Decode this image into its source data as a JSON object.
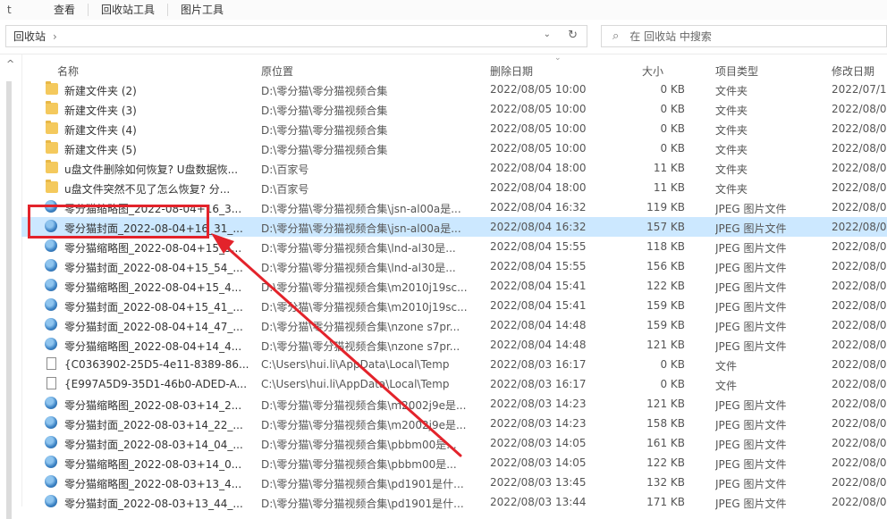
{
  "ribbon": {
    "lead": "t",
    "tabs": [
      "查看",
      "回收站工具",
      "图片工具"
    ]
  },
  "address": {
    "path": "回收站",
    "chevron": "›",
    "dropdown": "⌄",
    "refresh": "↻"
  },
  "search": {
    "placeholder": "在 回收站 中搜索"
  },
  "columns": {
    "name": "名称",
    "location": "原位置",
    "deleted": "删除日期",
    "size": "大小",
    "type": "项目类型",
    "modified": "修改日期"
  },
  "rows": [
    {
      "icon": "folder",
      "name": "新建文件夹 (2)",
      "location": "D:\\零分猫\\零分猫视频合集",
      "deleted": "2022/08/05 10:00",
      "size": "0 KB",
      "type": "文件夹",
      "modified": "2022/07/1"
    },
    {
      "icon": "folder",
      "name": "新建文件夹 (3)",
      "location": "D:\\零分猫\\零分猫视频合集",
      "deleted": "2022/08/05 10:00",
      "size": "0 KB",
      "type": "文件夹",
      "modified": "2022/08/0"
    },
    {
      "icon": "folder",
      "name": "新建文件夹 (4)",
      "location": "D:\\零分猫\\零分猫视频合集",
      "deleted": "2022/08/05 10:00",
      "size": "0 KB",
      "type": "文件夹",
      "modified": "2022/08/0"
    },
    {
      "icon": "folder",
      "name": "新建文件夹 (5)",
      "location": "D:\\零分猫\\零分猫视频合集",
      "deleted": "2022/08/05 10:00",
      "size": "0 KB",
      "type": "文件夹",
      "modified": "2022/08/0"
    },
    {
      "icon": "folder",
      "name": "u盘文件删除如何恢复? U盘数据恢...",
      "location": "D:\\百家号",
      "deleted": "2022/08/04 18:00",
      "size": "11 KB",
      "type": "文件夹",
      "modified": "2022/08/0"
    },
    {
      "icon": "folder",
      "name": "u盘文件突然不见了怎么恢复? 分...",
      "location": "D:\\百家号",
      "deleted": "2022/08/04 18:00",
      "size": "11 KB",
      "type": "文件夹",
      "modified": "2022/08/0"
    },
    {
      "icon": "jpeg",
      "name": "零分猫缩略图_2022-08-04+16_3...",
      "location": "D:\\零分猫\\零分猫视频合集\\jsn-al00a是...",
      "deleted": "2022/08/04 16:32",
      "size": "119 KB",
      "type": "JPEG 图片文件",
      "modified": "2022/08/0"
    },
    {
      "icon": "jpeg",
      "name": "零分猫封面_2022-08-04+16_31_...",
      "location": "D:\\零分猫\\零分猫视频合集\\jsn-al00a是...",
      "deleted": "2022/08/04 16:32",
      "size": "157 KB",
      "type": "JPEG 图片文件",
      "modified": "2022/08/0",
      "selected": true
    },
    {
      "icon": "jpeg",
      "name": "零分猫缩略图_2022-08-04+15_5...",
      "location": "D:\\零分猫\\零分猫视频合集\\lnd-al30是...",
      "deleted": "2022/08/04 15:55",
      "size": "118 KB",
      "type": "JPEG 图片文件",
      "modified": "2022/08/0"
    },
    {
      "icon": "jpeg",
      "name": "零分猫封面_2022-08-04+15_54_...",
      "location": "D:\\零分猫\\零分猫视频合集\\lnd-al30是...",
      "deleted": "2022/08/04 15:55",
      "size": "156 KB",
      "type": "JPEG 图片文件",
      "modified": "2022/08/0"
    },
    {
      "icon": "jpeg",
      "name": "零分猫缩略图_2022-08-04+15_4...",
      "location": "D:\\零分猫\\零分猫视频合集\\m2010j19sc...",
      "deleted": "2022/08/04 15:41",
      "size": "122 KB",
      "type": "JPEG 图片文件",
      "modified": "2022/08/0"
    },
    {
      "icon": "jpeg",
      "name": "零分猫封面_2022-08-04+15_41_...",
      "location": "D:\\零分猫\\零分猫视频合集\\m2010j19sc...",
      "deleted": "2022/08/04 15:41",
      "size": "159 KB",
      "type": "JPEG 图片文件",
      "modified": "2022/08/0"
    },
    {
      "icon": "jpeg",
      "name": "零分猫封面_2022-08-04+14_47_...",
      "location": "D:\\零分猫\\零分猫视频合集\\nzone s7pr...",
      "deleted": "2022/08/04 14:48",
      "size": "159 KB",
      "type": "JPEG 图片文件",
      "modified": "2022/08/0"
    },
    {
      "icon": "jpeg",
      "name": "零分猫缩略图_2022-08-04+14_4...",
      "location": "D:\\零分猫\\零分猫视频合集\\nzone s7pr...",
      "deleted": "2022/08/04 14:48",
      "size": "121 KB",
      "type": "JPEG 图片文件",
      "modified": "2022/08/0"
    },
    {
      "icon": "file",
      "name": "{C0363902-25D5-4e11-8389-86...",
      "location": "C:\\Users\\hui.li\\AppData\\Local\\Temp",
      "deleted": "2022/08/03 16:17",
      "size": "0 KB",
      "type": "文件",
      "modified": "2022/08/0"
    },
    {
      "icon": "file",
      "name": "{E997A5D9-35D1-46b0-ADED-A...",
      "location": "C:\\Users\\hui.li\\AppData\\Local\\Temp",
      "deleted": "2022/08/03 16:17",
      "size": "0 KB",
      "type": "文件",
      "modified": "2022/08/0"
    },
    {
      "icon": "jpeg",
      "name": "零分猫缩略图_2022-08-03+14_2...",
      "location": "D:\\零分猫\\零分猫视频合集\\m2002j9e是...",
      "deleted": "2022/08/03 14:23",
      "size": "121 KB",
      "type": "JPEG 图片文件",
      "modified": "2022/08/0"
    },
    {
      "icon": "jpeg",
      "name": "零分猫封面_2022-08-03+14_22_...",
      "location": "D:\\零分猫\\零分猫视频合集\\m2002j9e是...",
      "deleted": "2022/08/03 14:23",
      "size": "158 KB",
      "type": "JPEG 图片文件",
      "modified": "2022/08/0"
    },
    {
      "icon": "jpeg",
      "name": "零分猫封面_2022-08-03+14_04_...",
      "location": "D:\\零分猫\\零分猫视频合集\\pbbm00是...",
      "deleted": "2022/08/03 14:05",
      "size": "161 KB",
      "type": "JPEG 图片文件",
      "modified": "2022/08/0"
    },
    {
      "icon": "jpeg",
      "name": "零分猫缩略图_2022-08-03+14_0...",
      "location": "D:\\零分猫\\零分猫视频合集\\pbbm00是...",
      "deleted": "2022/08/03 14:05",
      "size": "122 KB",
      "type": "JPEG 图片文件",
      "modified": "2022/08/0"
    },
    {
      "icon": "jpeg",
      "name": "零分猫缩略图_2022-08-03+13_4...",
      "location": "D:\\零分猫\\零分猫视频合集\\pd1901是什...",
      "deleted": "2022/08/03 13:45",
      "size": "132 KB",
      "type": "JPEG 图片文件",
      "modified": "2022/08/0"
    },
    {
      "icon": "jpeg",
      "name": "零分猫封面_2022-08-03+13_44_...",
      "location": "D:\\零分猫\\零分猫视频合集\\pd1901是什...",
      "deleted": "2022/08/03 13:44",
      "size": "171 KB",
      "type": "JPEG 图片文件",
      "modified": "2022/08/0"
    }
  ],
  "colors": {
    "selection": "#cce8ff",
    "annotation": "#e3232b",
    "folder": "#f4c95d"
  }
}
